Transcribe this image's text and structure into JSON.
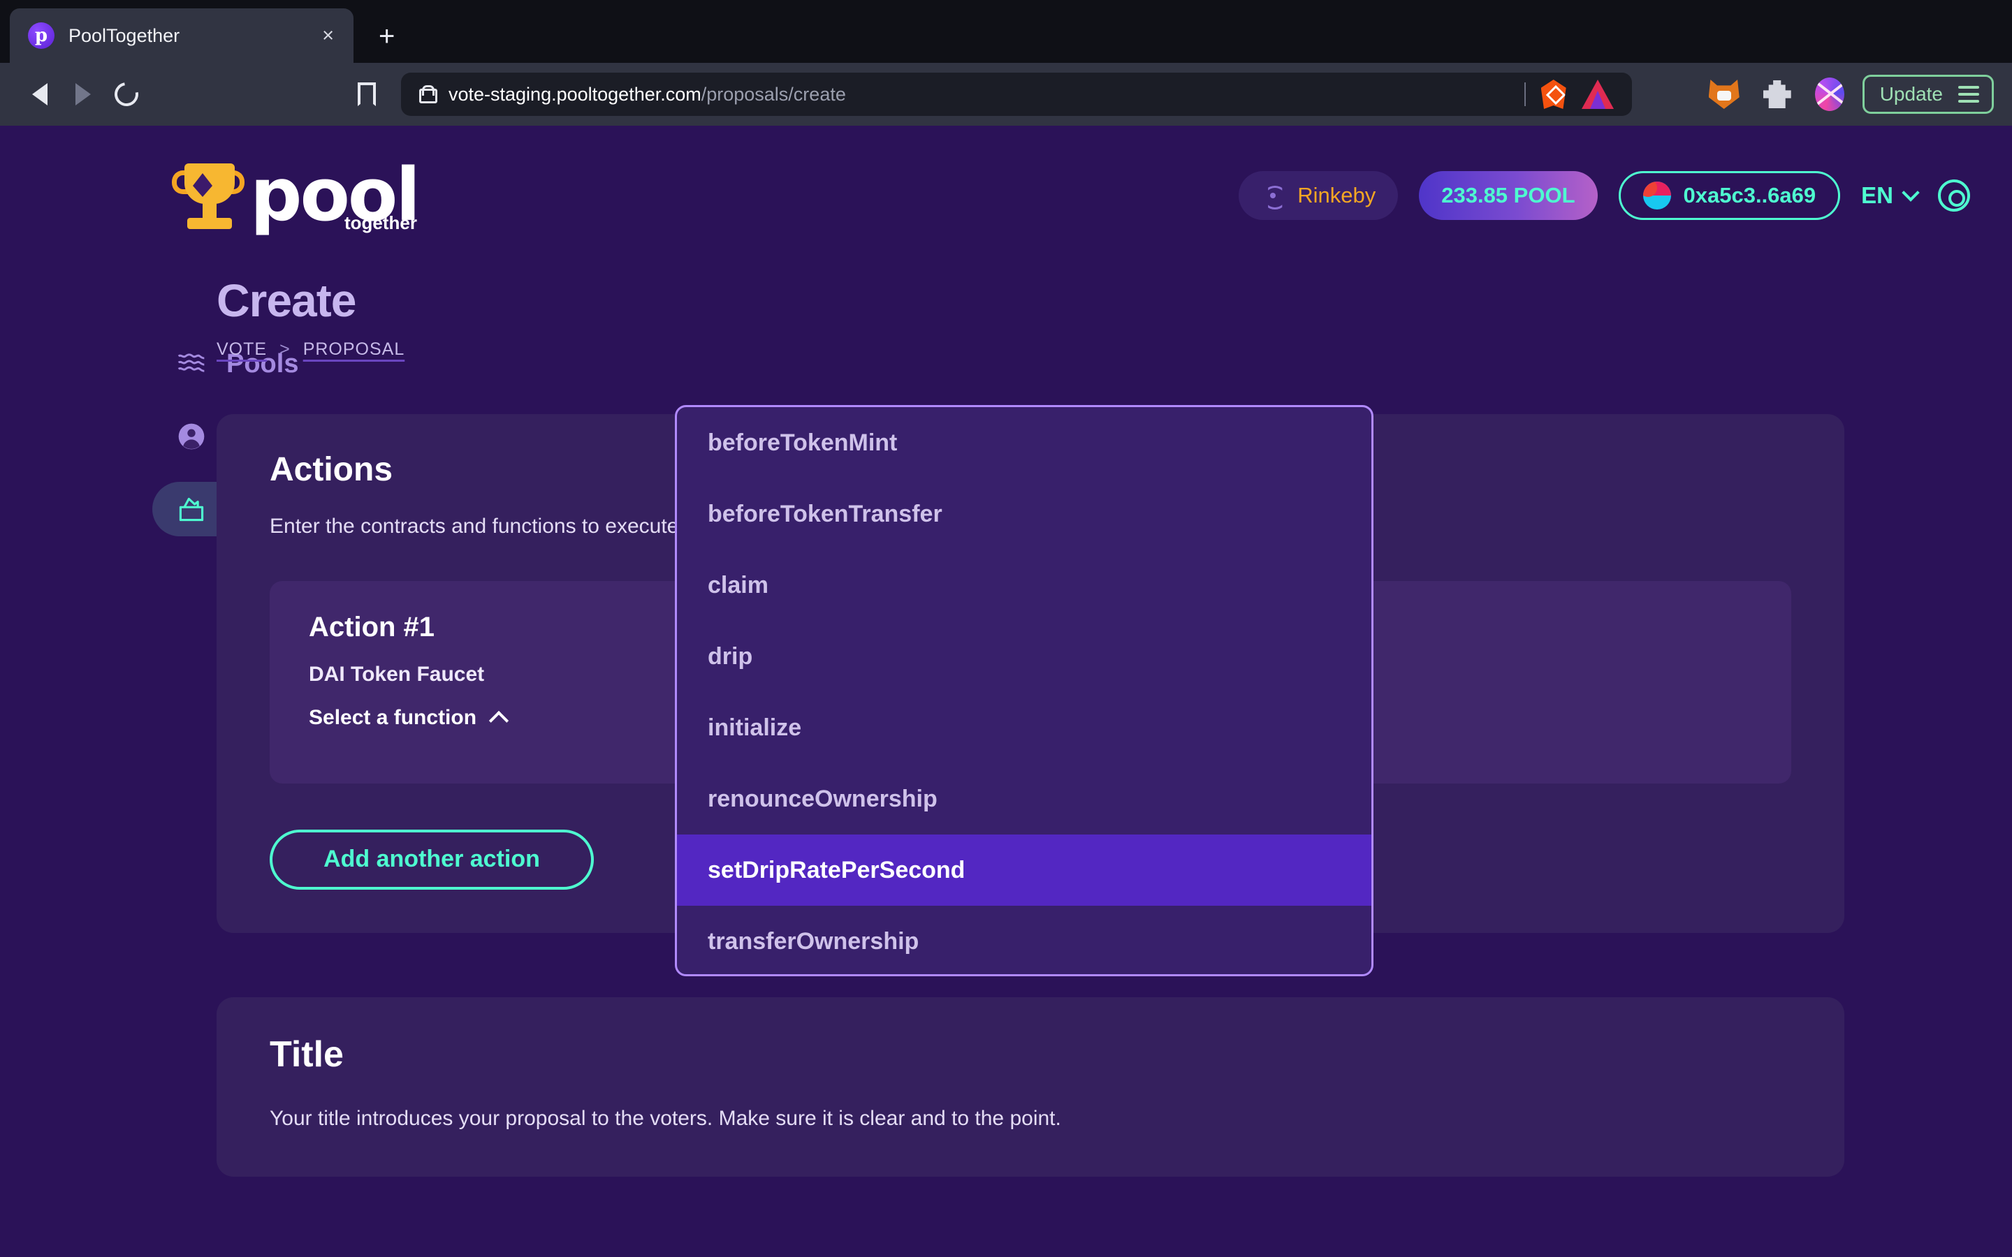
{
  "browser": {
    "tab": {
      "title": "PoolTogether",
      "favicon": "pooltogether-favicon",
      "close_label": "×"
    },
    "new_tab_label": "+",
    "url": {
      "domain": "vote-staging.pooltogether.com",
      "path": "/proposals/create"
    },
    "extensions": [
      "brave-shields-lion-icon",
      "brave-rewards-triangle-icon",
      "metamask-fox-icon",
      "extensions-puzzle-icon",
      "rainbow-wallet-icon"
    ],
    "update_button": {
      "label": "Update"
    },
    "nav": {
      "back": "back-arrow",
      "forward": "forward-arrow",
      "reload": "reload-icon",
      "bookmark": "bookmark-icon"
    }
  },
  "header": {
    "logo": {
      "primary": "pool",
      "secondary": "together"
    },
    "network": {
      "label": "Rinkeby"
    },
    "balance": {
      "label": "233.85 POOL"
    },
    "wallet": {
      "label": "0xa5c3..6a69"
    },
    "language": {
      "label": "EN"
    },
    "settings_icon": "gear-icon"
  },
  "sidebar": {
    "items": [
      {
        "label": "Pools",
        "icon": "waves-icon",
        "active": false
      },
      {
        "label": "Account",
        "icon": "person-icon",
        "active": false
      },
      {
        "label": "Vote",
        "icon": "ballot-box-icon",
        "active": true
      }
    ]
  },
  "main": {
    "title": "Create",
    "breadcrumb": {
      "item1": "VOTE",
      "separator": ">",
      "item2": "PROPOSAL"
    },
    "actions_card": {
      "heading": "Actions",
      "description": "Enter the contracts and functions to execute. Actions fire in the order laid out here (ie. Action #1 fires, then Action #2).",
      "action": {
        "heading": "Action #1",
        "contract": "DAI Token Faucet",
        "function_select_label": "Select a function",
        "function_select_chevron": "chevron-up-icon"
      },
      "add_button": "Add another action"
    },
    "title_card": {
      "heading": "Title",
      "description": "Your title introduces your proposal to the voters. Make sure it is clear and to the point."
    }
  },
  "dropdown": {
    "options": [
      {
        "label": "beforeTokenMint",
        "selected": false
      },
      {
        "label": "beforeTokenTransfer",
        "selected": false
      },
      {
        "label": "claim",
        "selected": false
      },
      {
        "label": "drip",
        "selected": false
      },
      {
        "label": "initialize",
        "selected": false
      },
      {
        "label": "renounceOwnership",
        "selected": false
      },
      {
        "label": "setDripRatePerSecond",
        "selected": true
      },
      {
        "label": "transferOwnership",
        "selected": false
      }
    ]
  },
  "colors": {
    "page_bg": "#2b1258",
    "card_bg": "#35205e",
    "action_bg": "#40276b",
    "accent_teal": "#4efcd0",
    "accent_purple": "#5327c2",
    "dropdown_border": "#b18aff",
    "network_orange": "#f5a623"
  }
}
